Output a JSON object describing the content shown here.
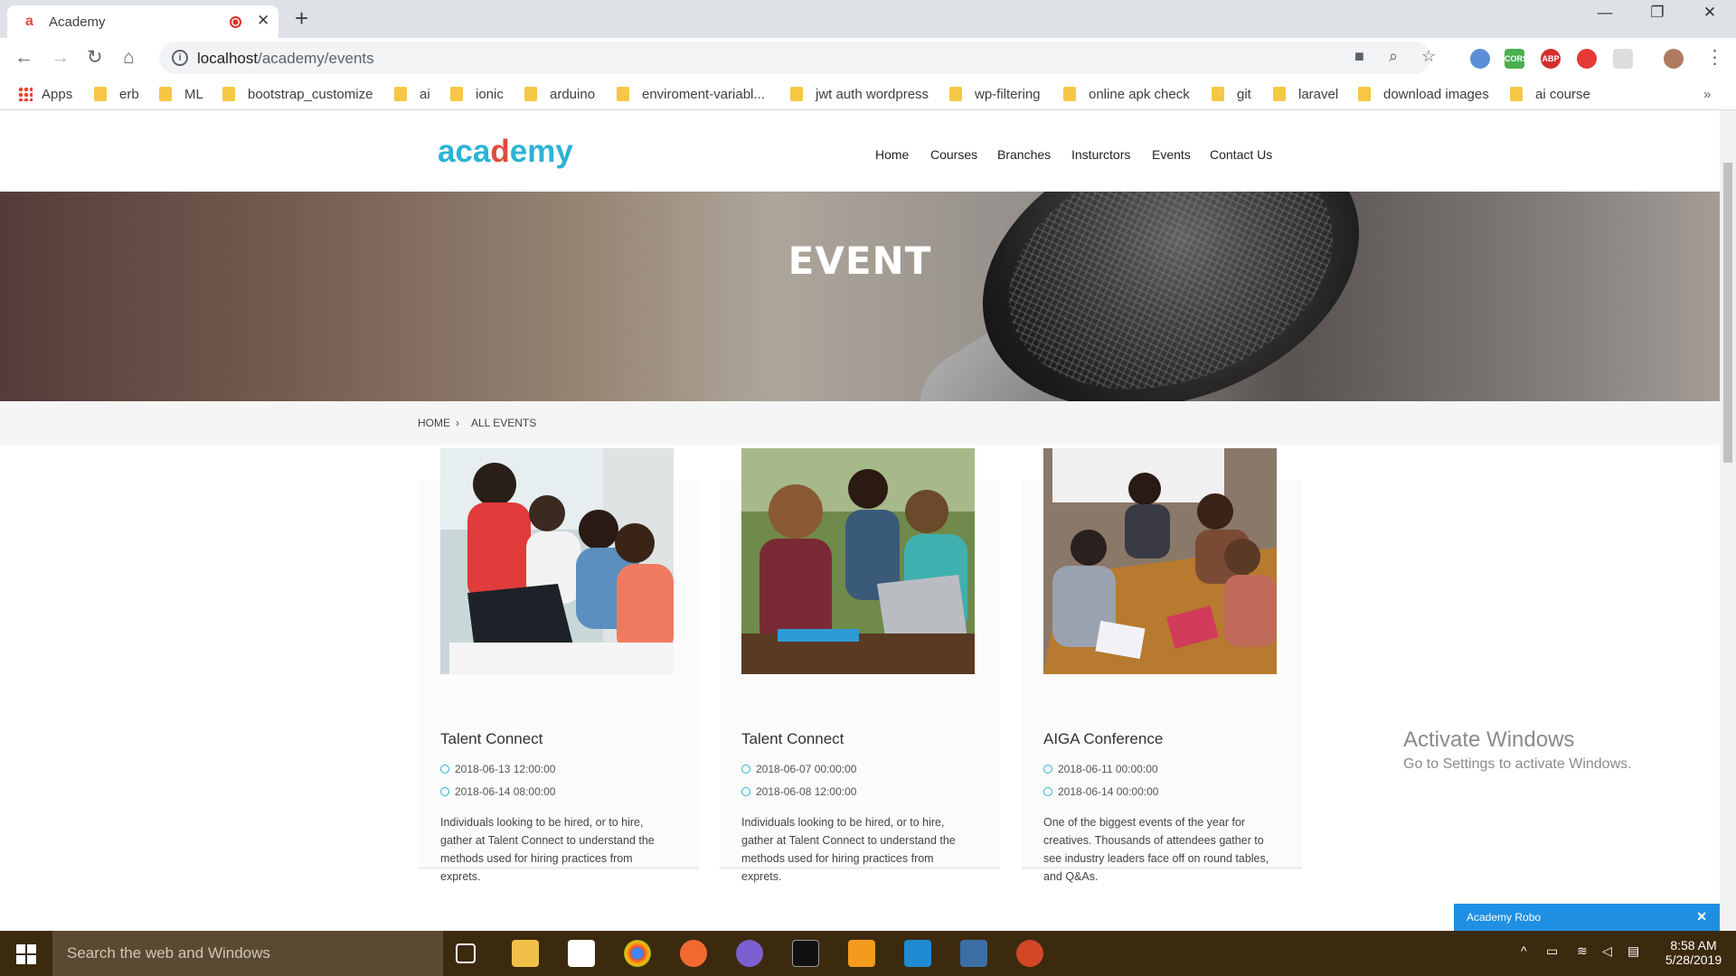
{
  "browser": {
    "tab_title": "Academy",
    "url_host": "localhost",
    "url_path": "/academy/events",
    "bookmarks": [
      "Apps",
      "erb",
      "ML",
      "bootstrap_customize",
      "ai",
      "ionic",
      "arduino",
      "enviroment-variabl...",
      "jwt auth wordpress",
      "wp-filtering",
      "online apk check",
      "git",
      "laravel",
      "download images",
      "ai course"
    ],
    "ext_cors": "CORS",
    "ext_abp": "ABP"
  },
  "site": {
    "logo_prefix": "aca",
    "logo_mid": "d",
    "logo_suffix": "emy",
    "nav": [
      "Home",
      "Courses",
      "Branches",
      "Insturctors",
      "Events",
      "Contact Us"
    ],
    "hero_title": "EVENT",
    "breadcrumb": [
      "HOME",
      "ALL EVENTS"
    ],
    "breadcrumb_sep": "›"
  },
  "events": [
    {
      "title": "Talent Connect",
      "start": "2018-06-13 12:00:00",
      "end": "2018-06-14 08:00:00",
      "desc": "Individuals looking to be hired, or to hire, gather at Talent Connect to understand the methods used for hiring practices from exprets."
    },
    {
      "title": "Talent Connect",
      "start": "2018-06-07 00:00:00",
      "end": "2018-06-08 12:00:00",
      "desc": "Individuals looking to be hired, or to hire, gather at Talent Connect to understand the methods used for hiring practices from exprets."
    },
    {
      "title": "AIGA Conference",
      "start": "2018-06-11 00:00:00",
      "end": "2018-06-14 00:00:00",
      "desc": "One of the biggest events of the year for creatives. Thousands of attendees gather to see industry leaders face off on round tables, and Q&As."
    }
  ],
  "windows": {
    "activate_title": "Activate Windows",
    "activate_sub": "Go to Settings to activate Windows.",
    "chat_widget": "Academy Robo",
    "search_placeholder": "Search the web and Windows",
    "time": "8:58 AM",
    "date": "5/28/2019"
  },
  "colors": {
    "accent": "#2bb3d6",
    "logo_red": "#e04a3a",
    "chat_blue": "#1e8fe3",
    "taskbar": "#3c2a0e"
  }
}
